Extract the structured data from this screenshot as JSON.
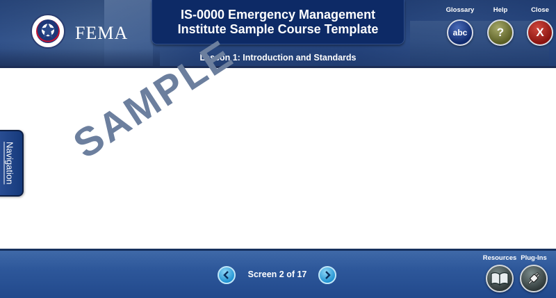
{
  "header": {
    "agency": "FEMA",
    "seal_text": "U.S. DEPARTMENT OF HOMELAND SECURITY",
    "course_title_line1": "IS-0000 Emergency Management",
    "course_title_line2": "Institute Sample Course Template",
    "lesson_title": "Lesson 1: Introduction and Standards",
    "buttons": {
      "glossary_label": "Glossary",
      "glossary_icon_text": "abc",
      "help_label": "Help",
      "help_icon_text": "?",
      "close_label": "Close",
      "close_icon_text": "X"
    }
  },
  "content": {
    "watermark": "SAMPLE"
  },
  "navigation_tab": {
    "label": "Navigation"
  },
  "footer": {
    "screen_counter": "Screen 2 of 17",
    "prev_icon": "chevron-left-icon",
    "next_icon": "chevron-right-icon",
    "resources_label": "Resources",
    "plugins_label": "Plug-Ins"
  },
  "colors": {
    "header_blue": "#2a4a82",
    "title_box": "#0d2a66",
    "footer_blue": "#2d579a",
    "watermark": "#6c7f9e",
    "glossary_btn": "#1e3a8a",
    "help_btn": "#7b7f3a",
    "close_btn": "#b0201a",
    "arrow_btn": "#3ab0e6"
  }
}
